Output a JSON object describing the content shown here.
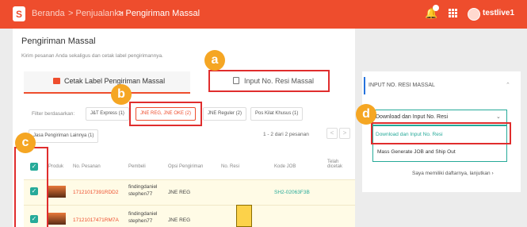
{
  "topbar": {
    "logo": "S",
    "breadcrumbs": [
      "Beranda",
      "> Penjualanku",
      "> Pengiriman Massal"
    ],
    "username": "testlive1"
  },
  "page": {
    "title": "Pengiriman Massal",
    "subtitle": "Kirim pesanan Anda sekaligus dan cetak label pengirimannya."
  },
  "tabs": {
    "cetak": "Cetak Label Pengiriman Massal",
    "input": "Input No. Resi Massal"
  },
  "filter": {
    "label": "Filter berdasarkan:",
    "chips": [
      "J&T Express (1)",
      "JNE REG, JNE OKE (2)",
      "JNE Reguler (2)",
      "Pos Kilat Khusus (1)"
    ],
    "chip_other": "Jasa Pengiriman Lainnya (1)"
  },
  "pager": {
    "text": "1 - 2 dari 2 pesanan",
    "prev": "<",
    "next": ">"
  },
  "table": {
    "headers": [
      "Produk",
      "No. Pesanan",
      "Pembeli",
      "Opsi Pengiriman",
      "No. Resi",
      "Kode JOB",
      "Telah dicetak"
    ],
    "rows": [
      {
        "order": "17121017391RDD2",
        "buyer_1": "findingdaniel",
        "buyer_2": "stephen77",
        "shipping": "JNE REG",
        "job": "SH2-02063F3B"
      },
      {
        "order": "17121017471RM7A",
        "buyer_1": "findingdaniel",
        "buyer_2": "stephen77",
        "shipping": "JNE REG",
        "job": ""
      }
    ]
  },
  "panel": {
    "title": "INPUT NO. RESI MASSAL",
    "select_value": "Download dan Input No. Resi",
    "options": [
      "Download dan Input No. Resi",
      "Mass Generate JOB and Ship Out"
    ],
    "link": "Saya memiliki daftarnya, lanjutkan"
  },
  "callouts": [
    "a",
    "b",
    "c",
    "d"
  ],
  "colors": {
    "brand": "#ee4d2d",
    "accent": "#26aa99",
    "highlight": "#e02d2d",
    "callout": "#f5a623"
  }
}
